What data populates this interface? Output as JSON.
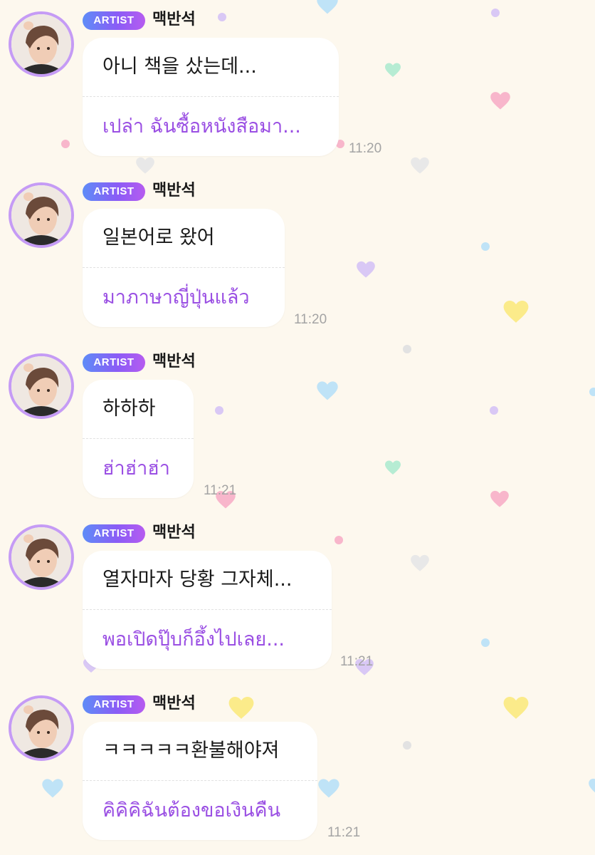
{
  "badge_label": "ARTIST",
  "colors": {
    "background": "#fdf8ee",
    "translation_text": "#9a4fe3",
    "badge_gradient": [
      "#5e8cf7",
      "#8a5cf6",
      "#b65cf0"
    ],
    "avatar_ring": "#c59bf5",
    "timestamp": "#a4a4a4"
  },
  "messages": [
    {
      "sender": "맥반석",
      "text": "아니 책을 샀는데...",
      "translation": "เปล่า ฉันซื้อหนังสือมา...",
      "time": "11:20"
    },
    {
      "sender": "맥반석",
      "text": "일본어로 왔어",
      "translation": "มาภาษาญี่ปุ่นแล้ว",
      "time": "11:20"
    },
    {
      "sender": "맥반석",
      "text": "하하하",
      "translation": "ฮ่าฮ่าฮ่า",
      "time": "11:21"
    },
    {
      "sender": "맥반석",
      "text": "열자마자 당황 그자체...",
      "translation": "พอเปิดปุ๊บก็อึ้งไปเลย...",
      "time": "11:21"
    },
    {
      "sender": "맥반석",
      "text": "ㅋㅋㅋㅋㅋ환불해야져",
      "translation": "คิคิคิฉันต้องขอเงินคืน",
      "time": "11:21"
    }
  ],
  "decorations": {
    "background_pattern": "heart-and-dot-confetti",
    "icons": [
      "heart-icon",
      "dot"
    ]
  }
}
